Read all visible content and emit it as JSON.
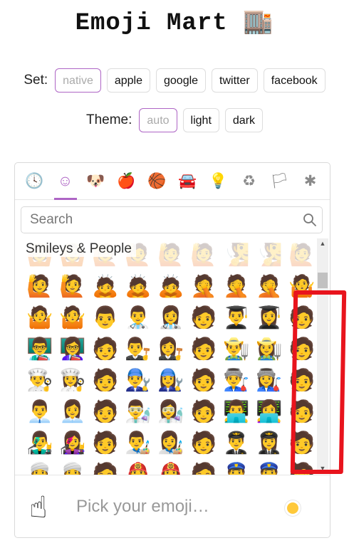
{
  "header": {
    "title": "Emoji Mart",
    "title_emoji": "🏬"
  },
  "set_selector": {
    "label": "Set:",
    "options": [
      "native",
      "apple",
      "google",
      "twitter",
      "facebook"
    ],
    "selected": "native"
  },
  "theme_selector": {
    "label": "Theme:",
    "options": [
      "auto",
      "light",
      "dark"
    ],
    "selected": "auto"
  },
  "picker": {
    "categories": [
      {
        "name": "frequently-used",
        "glyph": "🕓"
      },
      {
        "name": "smileys-people",
        "glyph": "☺"
      },
      {
        "name": "animals-nature",
        "glyph": "🐶"
      },
      {
        "name": "food-drink",
        "glyph": "🍎"
      },
      {
        "name": "activity",
        "glyph": "🏀"
      },
      {
        "name": "travel-places",
        "glyph": "🚘"
      },
      {
        "name": "objects",
        "glyph": "💡"
      },
      {
        "name": "symbols",
        "glyph": "♻"
      },
      {
        "name": "flags",
        "glyph": "🏳"
      },
      {
        "name": "custom",
        "glyph": "✱"
      }
    ],
    "selected_category": "smileys-people",
    "accent_color": "#ae65c5",
    "search_placeholder": "Search",
    "section_label": "Smileys & People",
    "grid_rows": [
      [
        "🙆",
        "🙆",
        "🙋",
        "🙋",
        "🙋",
        "🙋",
        "🧏",
        "🧏",
        "🙋"
      ],
      [
        "🙋",
        "🙋",
        "🙇",
        "🙇",
        "🙇",
        "🤦",
        "🤦",
        "🤦",
        "🤷"
      ],
      [
        "🤷",
        "🤷",
        "👨",
        "👨‍⚕️",
        "👩‍⚕️",
        "🧑",
        "👨‍🎓",
        "👩‍🎓",
        "🧑"
      ],
      [
        "👨‍🏫",
        "👩‍🏫",
        "🧑",
        "👨‍⚖️",
        "👩‍⚖️",
        "🧑",
        "👨‍🌾",
        "👩‍🌾",
        "🧑"
      ],
      [
        "👨‍🍳",
        "👩‍🍳",
        "🧑",
        "👨‍🔧",
        "👩‍🔧",
        "🧑",
        "👨‍🏭",
        "👩‍🏭",
        "🧑"
      ],
      [
        "👨‍💼",
        "👩‍💼",
        "🧑",
        "👨‍🔬",
        "👩‍🔬",
        "🧑",
        "👨‍💻",
        "👩‍💻",
        "🧑"
      ],
      [
        "👨‍🎤",
        "👩‍🎤",
        "🧑",
        "👨‍🎨",
        "👩‍🎨",
        "🧑",
        "👨‍✈️",
        "👩‍✈️",
        "🧑"
      ],
      [
        "👳",
        "👳",
        "🧑",
        "👨‍🚒",
        "👩‍🚒",
        "🧑",
        "👮",
        "👮",
        "🧑"
      ]
    ],
    "preview_emoji": "☝",
    "preview_text": "Pick your emoji…",
    "skin_tone_color": "#ffc93a"
  },
  "annotation_color": "#e8141d"
}
